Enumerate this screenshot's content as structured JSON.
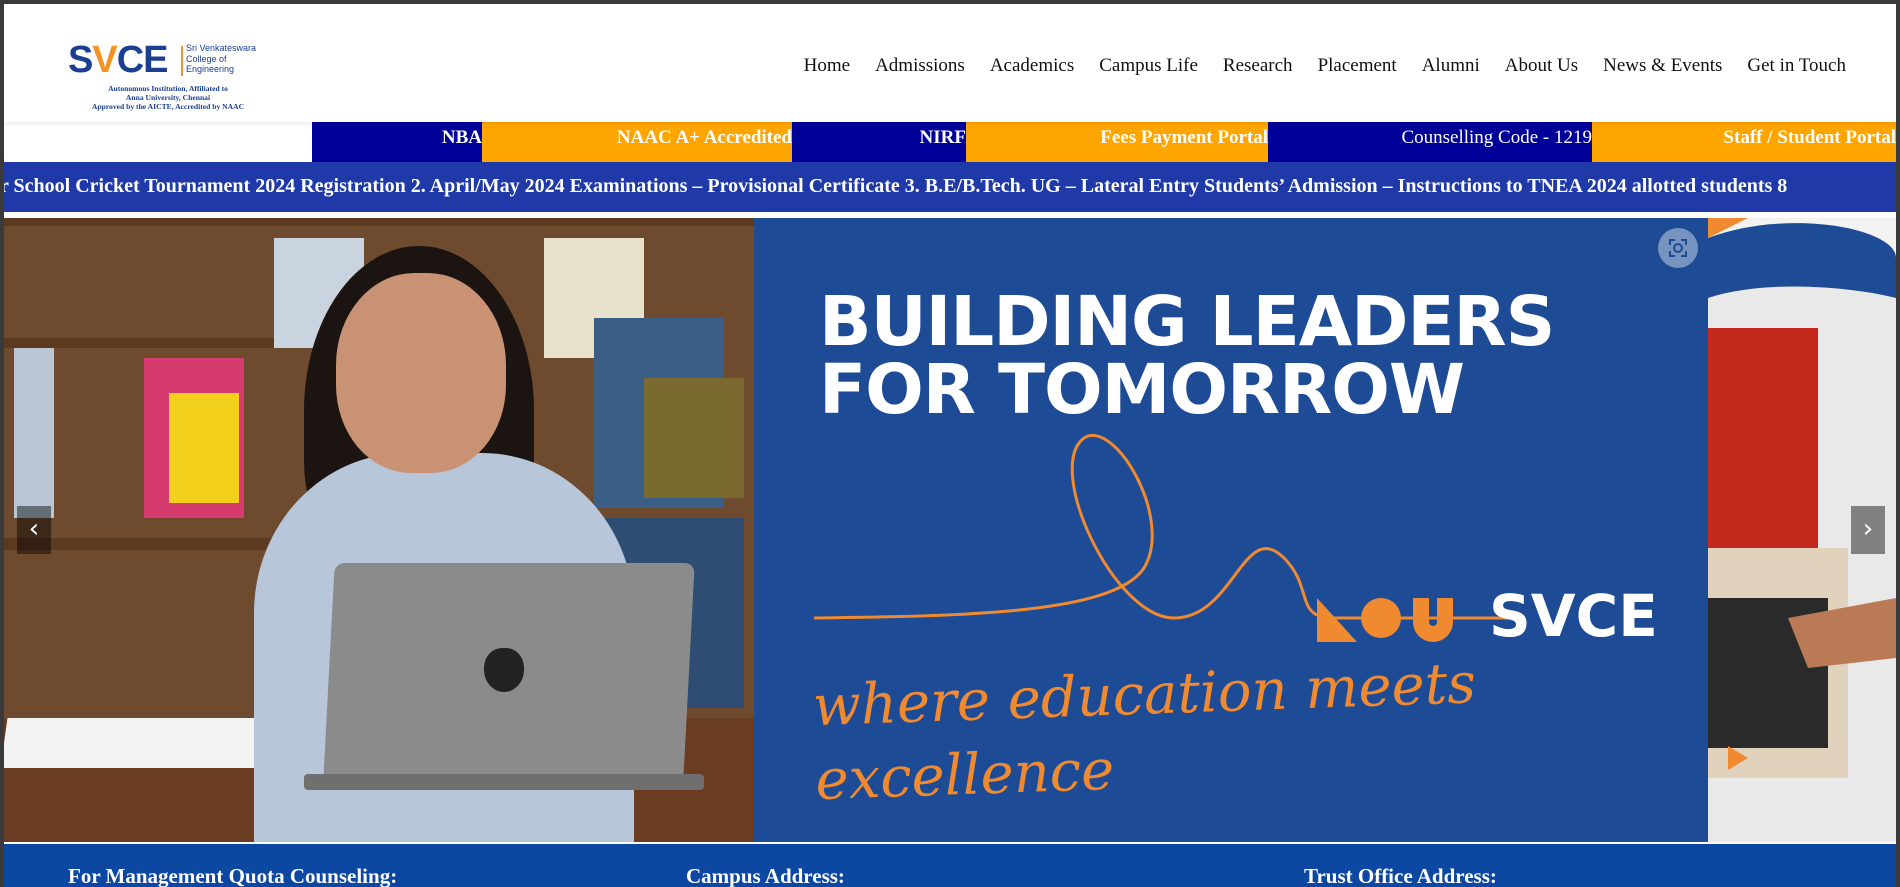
{
  "brand": {
    "logo_mark_left": "S",
    "logo_mark_v": "V",
    "logo_mark_right": "CE",
    "name": "Sri Venkateswara College of Engineering",
    "tagline_1": "Autonomous Institution, Affiliated to",
    "tagline_2": "Anna University, Chennai",
    "tagline_3": "Approved by the AICTE, Accredited by NAAC"
  },
  "nav": [
    {
      "label": "Home"
    },
    {
      "label": "Admissions"
    },
    {
      "label": "Academics"
    },
    {
      "label": "Campus Life"
    },
    {
      "label": "Research"
    },
    {
      "label": "Placement"
    },
    {
      "label": "Alumni"
    },
    {
      "label": "About Us"
    },
    {
      "label": "News & Events"
    },
    {
      "label": "Get in Touch"
    }
  ],
  "quick_links": [
    {
      "label": "NBA"
    },
    {
      "label": "NAAC A+ Accredited"
    },
    {
      "label": "NIRF"
    },
    {
      "label": "Fees Payment Portal"
    },
    {
      "label": "Counselling Code - 1219"
    },
    {
      "label": "Staff / Student Portal"
    }
  ],
  "ticker": {
    "text": "r School Cricket Tournament 2024 Registration 2. April/May 2024 Examinations – Provisional Certificate 3. B.E/B.Tech. UG – Lateral Entry Students’ Admission – Instructions to TNEA 2024 allotted students 8"
  },
  "hero": {
    "headline_1": "BUILDING LEADERS",
    "headline_2": "FOR TOMORROW",
    "tagline_1": "where education meets",
    "tagline_2": "excellence",
    "brand": "SVCE",
    "prev_label": "‹",
    "next_label": "›"
  },
  "footer": {
    "management_title": "For Management Quota Counseling:",
    "campus_title": "Campus Address:",
    "trust_title": "Trust Office Address:"
  },
  "colors": {
    "brand_blue": "#1c3f94",
    "brand_orange": "#f39322",
    "quick_blue": "#000099",
    "quick_orange": "#ffa500",
    "ticker_bg": "#1f3aa8",
    "banner_bg": "#1d4b96",
    "footer_bg": "#0c47a1"
  }
}
